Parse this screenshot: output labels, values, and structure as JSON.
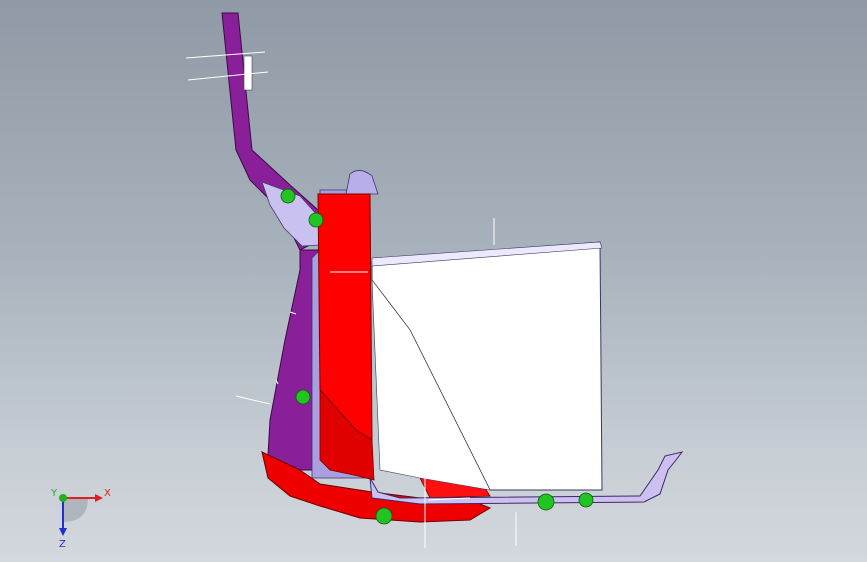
{
  "viewport": {
    "background_top": "#8f9aa6",
    "background_bottom": "#d3d8dd"
  },
  "model": {
    "parts": [
      {
        "name": "bracket-arm",
        "color": "#8a1f9a"
      },
      {
        "name": "red-plate",
        "color": "#ff0000"
      },
      {
        "name": "lavender-wall",
        "color": "#a99ee0"
      },
      {
        "name": "white-panel",
        "color": "#ffffff"
      },
      {
        "name": "weld-points",
        "color": "#22c422"
      }
    ]
  },
  "triad": {
    "x_label": "X",
    "y_label": "Y",
    "z_label": "Z",
    "x_color": "#e02020",
    "y_color": "#20b020",
    "z_color": "#2030d0"
  }
}
